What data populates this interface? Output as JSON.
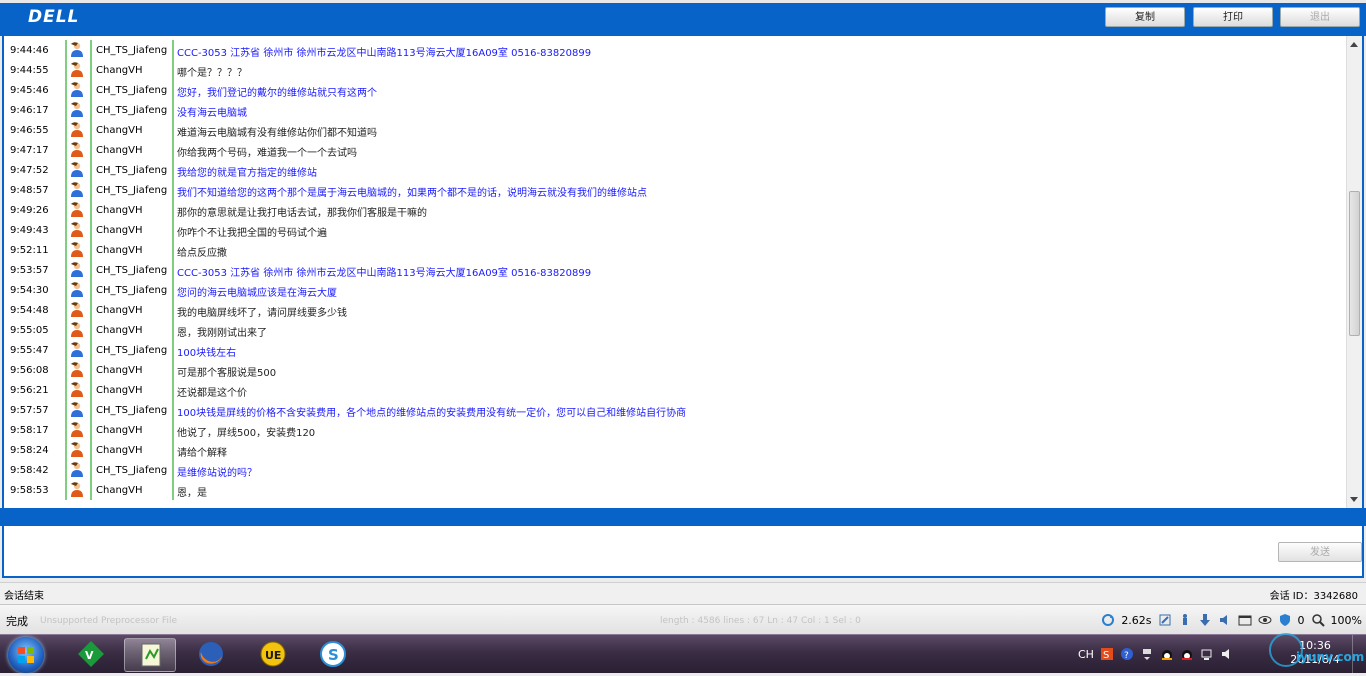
{
  "header": {
    "logo": "DELL",
    "copy_label": "复制",
    "print_label": "打印",
    "exit_label": "退出"
  },
  "chat": {
    "messages": [
      {
        "time": "9:44:46",
        "user": "CH_TS_Jiafeng",
        "role": "agent",
        "text": "CCC-3053 江苏省  徐州市  徐州市云龙区中山南路113号海云大厦16A09室  0516-83820899"
      },
      {
        "time": "9:44:55",
        "user": "ChangVH",
        "role": "cust",
        "text": "哪个是？？？？"
      },
      {
        "time": "9:45:46",
        "user": "CH_TS_Jiafeng",
        "role": "agent",
        "text": "您好，我们登记的戴尔的维修站就只有这两个"
      },
      {
        "time": "9:46:17",
        "user": "CH_TS_Jiafeng",
        "role": "agent",
        "text": "没有海云电脑城"
      },
      {
        "time": "9:46:55",
        "user": "ChangVH",
        "role": "cust",
        "text": "难道海云电脑城有没有维修站你们都不知道吗"
      },
      {
        "time": "9:47:17",
        "user": "ChangVH",
        "role": "cust",
        "text": "你给我两个号码，难道我一个一个去试吗"
      },
      {
        "time": "9:47:52",
        "user": "CH_TS_Jiafeng",
        "role": "agent",
        "text": "我给您的就是官方指定的维修站"
      },
      {
        "time": "9:48:57",
        "user": "CH_TS_Jiafeng",
        "role": "agent",
        "text": "我们不知道给您的这两个那个是属于海云电脑城的，如果两个都不是的话，说明海云就没有我们的维修站点"
      },
      {
        "time": "9:49:26",
        "user": "ChangVH",
        "role": "cust",
        "text": "那你的意思就是让我打电话去试，那我你们客服是干嘛的"
      },
      {
        "time": "9:49:43",
        "user": "ChangVH",
        "role": "cust",
        "text": "你咋个不让我把全国的号码试个遍"
      },
      {
        "time": "9:52:11",
        "user": "ChangVH",
        "role": "cust",
        "text": "给点反应撒"
      },
      {
        "time": "9:53:57",
        "user": "CH_TS_Jiafeng",
        "role": "agent",
        "text": "CCC-3053 江苏省  徐州市  徐州市云龙区中山南路113号海云大厦16A09室  0516-83820899"
      },
      {
        "time": "9:54:30",
        "user": "CH_TS_Jiafeng",
        "role": "agent",
        "text": "您问的海云电脑城应该是在海云大厦"
      },
      {
        "time": "9:54:48",
        "user": "ChangVH",
        "role": "cust",
        "text": "我的电脑屏线坏了，请问屏线要多少钱"
      },
      {
        "time": "9:55:05",
        "user": "ChangVH",
        "role": "cust",
        "text": "恩，我刚刚试出来了"
      },
      {
        "time": "9:55:47",
        "user": "CH_TS_Jiafeng",
        "role": "agent",
        "text": "100块钱左右"
      },
      {
        "time": "9:56:08",
        "user": "ChangVH",
        "role": "cust",
        "text": "可是那个客服说是500"
      },
      {
        "time": "9:56:21",
        "user": "ChangVH",
        "role": "cust",
        "text": "还说都是这个价"
      },
      {
        "time": "9:57:57",
        "user": "CH_TS_Jiafeng",
        "role": "agent",
        "text": "100块钱是屏线的价格不含安装费用，各个地点的维修站点的安装费用没有统一定价，您可以自己和维修站自行协商"
      },
      {
        "time": "9:58:17",
        "user": "ChangVH",
        "role": "cust",
        "text": "他说了，屏线500，安装费120"
      },
      {
        "time": "9:58:24",
        "user": "ChangVH",
        "role": "cust",
        "text": "请给个解释"
      },
      {
        "time": "9:58:42",
        "user": "CH_TS_Jiafeng",
        "role": "agent",
        "text": "是维修站说的吗？"
      },
      {
        "time": "9:58:53",
        "user": "ChangVH",
        "role": "cust",
        "text": "恩，是"
      }
    ]
  },
  "composer": {
    "send_label": "发送"
  },
  "session": {
    "status": "会话结束",
    "id_label": "会话 ID：3342680"
  },
  "browser_status": {
    "status": "完成",
    "ghost_left": "Unsupported Preprocessor File",
    "ghost_mid": "length : 4586    lines : 67             Ln : 47    Col : 1    Sel : 0",
    "load_time": "2.62s",
    "blocked_count": "0",
    "zoom": "100%"
  },
  "taskbar": {
    "lang": "CH",
    "time": "10:36",
    "date": "2011/8/4",
    "watermark": "iyunv.com"
  },
  "colors": {
    "dell_blue": "#0863c8",
    "agent_text": "#1a1aff",
    "customer_text": "#222222",
    "row_divider": "#7ed07e"
  },
  "icons": {
    "agent_avatar": "agent-person-icon",
    "customer_avatar": "customer-person-icon"
  }
}
